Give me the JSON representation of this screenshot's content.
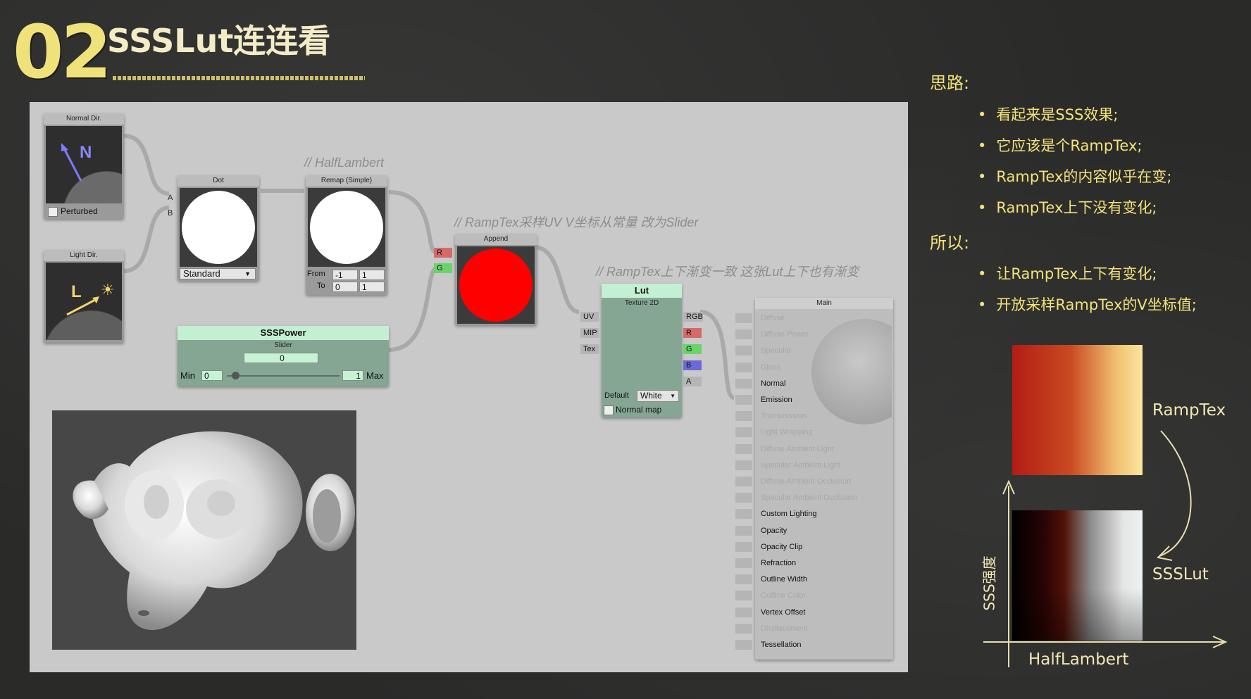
{
  "slide": {
    "number": "02",
    "title": "SSSLut连连看"
  },
  "editor": {
    "comments": {
      "halflambert": "// HalfLambert",
      "ramptex_uv": "// RampTex采样UV V坐标从常量 改为Slider",
      "ramptex_gradient": "// RampTex上下渐变一致 这张Lut上下也有渐变"
    },
    "normal_dir": {
      "title": "Normal Dir.",
      "glyph": "N",
      "checkbox_label": "Perturbed"
    },
    "light_dir": {
      "title": "Light Dir.",
      "glyph": "L"
    },
    "dot": {
      "title": "Dot",
      "mode": "Standard",
      "port_a": "A",
      "port_b": "B"
    },
    "remap": {
      "title": "Remap (Simple)",
      "from_label": "From",
      "to_label": "To",
      "from_min": "-1",
      "from_max": "1",
      "to_min": "0",
      "to_max": "1"
    },
    "append": {
      "title": "Append",
      "port_r": "R",
      "port_g": "G"
    },
    "ssspower": {
      "title": "SSSPower",
      "subtitle": "Slider",
      "value": "0",
      "min_label": "Min",
      "min_value": "0",
      "max_value": "1",
      "max_label": "Max"
    },
    "lut": {
      "title": "Lut",
      "subtitle": "Texture 2D",
      "in_ports": [
        "UV",
        "MIP",
        "Tex"
      ],
      "out_ports": [
        "RGB",
        "R",
        "G",
        "B",
        "A"
      ],
      "default_label": "Default",
      "default_value": "White",
      "normal_map_label": "Normal map"
    },
    "main": {
      "title": "Main",
      "props": [
        {
          "label": "Diffuse",
          "active": false
        },
        {
          "label": "Diffuse Power",
          "active": false
        },
        {
          "label": "Specular",
          "active": false
        },
        {
          "label": "Gloss",
          "active": false
        },
        {
          "label": "Normal",
          "active": true
        },
        {
          "label": "Emission",
          "active": true
        },
        {
          "label": "Transmission",
          "active": false
        },
        {
          "label": "Light Wrapping",
          "active": false
        },
        {
          "label": "Diffuse Ambient Light",
          "active": false
        },
        {
          "label": "Specular Ambient Light",
          "active": false
        },
        {
          "label": "Diffuse Ambient Occlusion",
          "active": false
        },
        {
          "label": "Specular Ambient Occlusion",
          "active": false
        },
        {
          "label": "Custom Lighting",
          "active": true
        },
        {
          "label": "Opacity",
          "active": true
        },
        {
          "label": "Opacity Clip",
          "active": true
        },
        {
          "label": "Refraction",
          "active": true
        },
        {
          "label": "Outline Width",
          "active": true
        },
        {
          "label": "Outline Color",
          "active": false
        },
        {
          "label": "Vertex Offset",
          "active": true
        },
        {
          "label": "Displacement",
          "active": false
        },
        {
          "label": "Tessellation",
          "active": true
        }
      ]
    }
  },
  "notes": {
    "heading1": "思路:",
    "bullets1": [
      "看起来是SSS效果;",
      "它应该是个RampTex;",
      "RampTex的内容似乎在变;",
      "RampTex上下没有变化;"
    ],
    "heading2": "所以:",
    "bullets2": [
      "让RampTex上下有变化;",
      "开放采样RampTex的V坐标值;"
    ]
  },
  "diagram": {
    "ramptex_label": "RampTex",
    "ssslut_label": "SSSLut",
    "y_axis_label": "SSS强度",
    "x_axis_label": "HalfLambert"
  },
  "colors": {
    "accent_yellow": "#f2e37a",
    "node_green": "#bfeccd",
    "append_red": "#ff0000"
  }
}
